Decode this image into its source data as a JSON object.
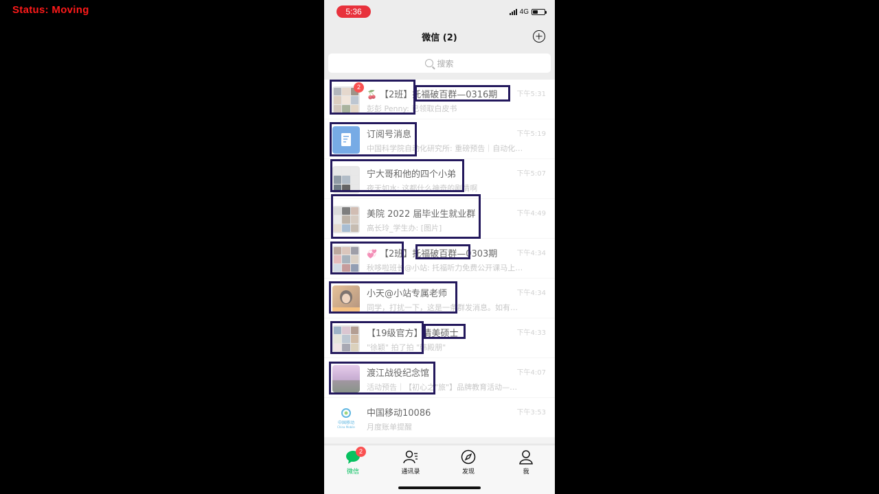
{
  "overlay": {
    "status_text": "Status:  Moving"
  },
  "statusbar": {
    "time": "5:36",
    "network": "4G",
    "battery_level": 0.45
  },
  "nav": {
    "title": "微信 (2)",
    "add_icon": "plus-circle-icon"
  },
  "search": {
    "placeholder": "搜索",
    "icon": "search-icon"
  },
  "chats": [
    {
      "emoji": "🍒",
      "name": "【2班】托福破百群—0316期",
      "preview": "彭彭 Penny: 已领取白皮书",
      "time": "下午5:31",
      "badge": "2",
      "avatar": "grid",
      "colors": [
        "#8a8f99",
        "#d8c4b2",
        "#6b5b4b",
        "#c9b4a0",
        "#e8d8c8",
        "#9aa8b8",
        "#b8a898",
        "#7b8b6b",
        "#d4c0a8"
      ]
    },
    {
      "emoji": "",
      "name": "订阅号消息",
      "preview": "中国科学院自动化研究所: 重磅预告｜自动化所…",
      "time": "下午5:19",
      "badge": "",
      "avatar": "doc",
      "colors": [
        "#2f7fd8"
      ]
    },
    {
      "emoji": "",
      "name": "宁大哥和他的四个小弟",
      "preview": "夜天如水: 这都什么神奇的剧情啊",
      "time": "下午5:07",
      "badge": "",
      "avatar": "grid",
      "colors": [
        "#dcdcdc",
        "#dcdcdc",
        "#dcdcdc",
        "#556677",
        "#8899aa",
        "#dcdcdc",
        "#223344",
        "#111111",
        "#dcdcdc"
      ]
    },
    {
      "emoji": "",
      "name": "美院 2022 届毕业生就业群",
      "preview": "高长玲_学生办: [图片]",
      "time": "下午4:49",
      "badge": "",
      "avatar": "grid",
      "colors": [
        "#c8c8c8",
        "#3a3a3a",
        "#b89a8a",
        "#e0e0e0",
        "#9a8a7a",
        "#c0b0a0",
        "#d8c8b8",
        "#7a9aba",
        "#a89888"
      ]
    },
    {
      "emoji": "💞",
      "name": "【2班】托福破百群—0303期",
      "preview": "秋哆啦班长@小站: 托福听力免费公开课马上于1…",
      "time": "下午4:34",
      "badge": "",
      "avatar": "grid",
      "colors": [
        "#9a7a6a",
        "#c8a898",
        "#6a6a7a",
        "#d89898",
        "#7a8a9a",
        "#c8b8a8",
        "#b8c8d8",
        "#a86868",
        "#5a6a8a"
      ]
    },
    {
      "emoji": "",
      "name": "小天@小站专属老师",
      "preview": "同学，打扰一下，这是一条群发消息。如有打扰…",
      "time": "下午4:34",
      "badge": "",
      "avatar": "photo",
      "colors": [
        "#c89058"
      ]
    },
    {
      "emoji": "",
      "name": "【19级官方】清美硕士",
      "preview": "\"徐颖\" 拍了拍 \"韩殿朋\"",
      "time": "下午4:33",
      "badge": "",
      "avatar": "grid",
      "colors": [
        "#6a8aaa",
        "#c8a8b8",
        "#8a6a5a",
        "#d8d8c8",
        "#9aaabb",
        "#b89878",
        "#e8d8d8",
        "#7a7a8a",
        "#c8b898"
      ]
    },
    {
      "emoji": "",
      "name": "渡江战役纪念馆",
      "preview": "活动预告｜【初心之\"旅\"】品牌教育活动——\"…",
      "time": "下午4:07",
      "badge": "",
      "avatar": "landscape",
      "colors": [
        "#b890c8"
      ]
    },
    {
      "emoji": "",
      "name": "中国移动10086",
      "preview": "月度账单提醒",
      "time": "下午3:53",
      "badge": "",
      "avatar": "cmcc",
      "colors": [
        "#0a8fd1"
      ]
    }
  ],
  "cmcc_logo_text": "中国移动 China Mobile",
  "tabbar": [
    {
      "label": "微信",
      "icon": "chat-bubble-icon",
      "active": true,
      "badge": "2"
    },
    {
      "label": "通讯录",
      "icon": "contacts-icon",
      "active": false,
      "badge": ""
    },
    {
      "label": "发现",
      "icon": "compass-icon",
      "active": false,
      "badge": ""
    },
    {
      "label": "我",
      "icon": "person-icon",
      "active": false,
      "badge": ""
    }
  ]
}
